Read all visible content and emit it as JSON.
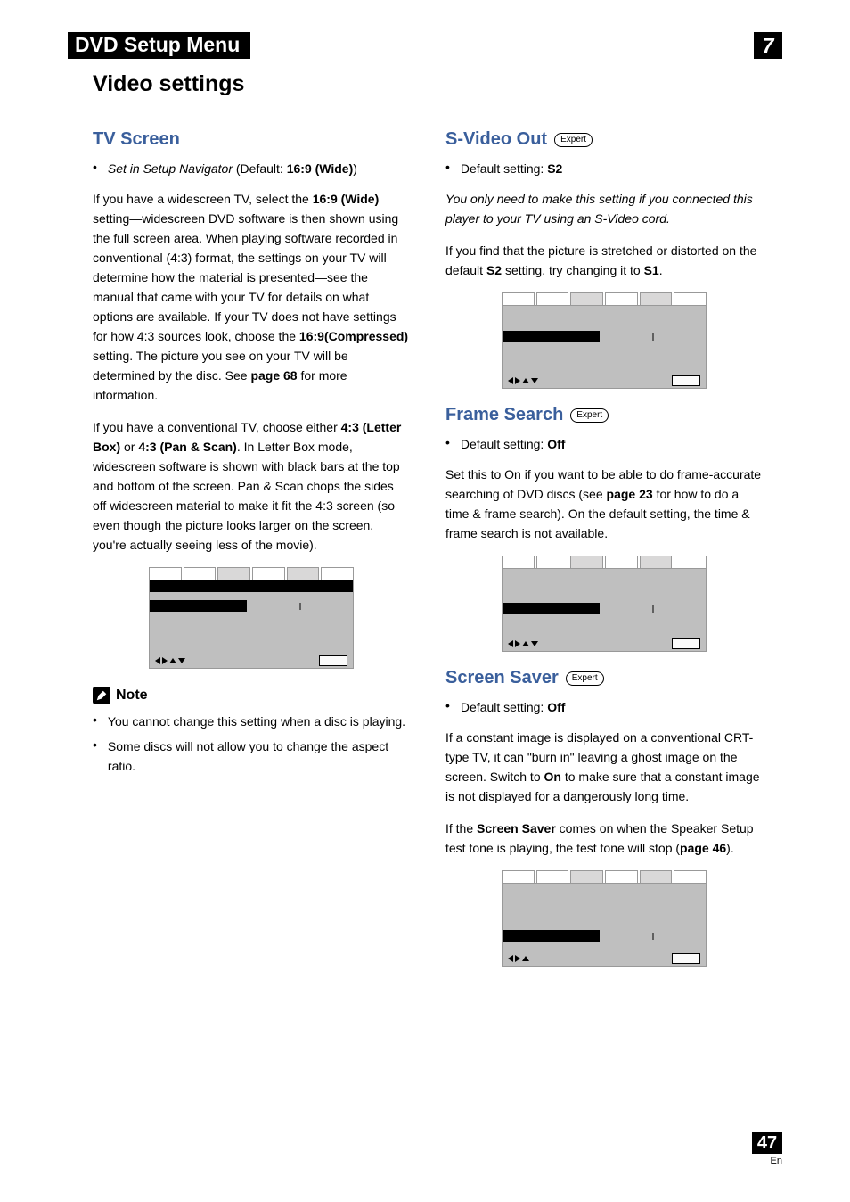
{
  "header": {
    "title": "DVD Setup Menu",
    "chapter": "7"
  },
  "section_title": "Video settings",
  "left": {
    "tv_screen": {
      "heading": "TV Screen",
      "set_in": "Set in Setup Navigator",
      "default_label": " (Default: ",
      "default_value": "16:9 (Wide)",
      "default_close": ")",
      "p1_a": "If you have a widescreen TV, select the ",
      "p1_b": "16:9 (Wide)",
      "p1_c": " setting—widescreen DVD software is then shown using the full screen area. When playing software recorded in conventional (4:3) format, the settings on your TV will determine how the material is presented—see the manual that came with your TV for details on what options are available. If your TV does not have settings for how 4:3 sources look, choose the ",
      "p1_d": "16:9(Compressed)",
      "p1_e": " setting. The picture you see on your TV will be determined by the disc. See ",
      "p1_f": "page 68",
      "p1_g": " for more information.",
      "p2_a": "If you have a conventional TV, choose either ",
      "p2_b": "4:3 (Letter Box)",
      "p2_c": " or ",
      "p2_d": "4:3 (Pan & Scan)",
      "p2_e": ". In Letter Box mode, widescreen software is shown with black bars at the top and bottom of the screen. Pan & Scan chops the sides off widescreen material to make it fit the 4:3 screen (so even though the picture looks larger on the screen, you're actually seeing less of the movie)."
    },
    "note": {
      "title": "Note",
      "items": [
        "You cannot change this setting when a disc is playing.",
        "Some discs will not allow you to change the aspect ratio."
      ]
    }
  },
  "right": {
    "svideo": {
      "heading": "S-Video Out",
      "badge": "Expert",
      "default_label": "Default setting: ",
      "default_value": "S2",
      "p_italic": "You only need to make this setting if you connected this player to your TV using an S-Video cord.",
      "p2_a": "If you find that the picture is stretched or distorted on the default ",
      "p2_b": "S2",
      "p2_c": " setting, try changing it to ",
      "p2_d": "S1",
      "p2_e": "."
    },
    "framesearch": {
      "heading": "Frame Search",
      "badge": "Expert",
      "default_label": "Default setting: ",
      "default_value": "Off",
      "p_a": "Set this to On if you want to be able to do frame-accurate searching of DVD discs (see ",
      "p_b": "page 23",
      "p_c": " for how to do a time & frame search). On the default setting, the time & frame search is not available."
    },
    "screensaver": {
      "heading": "Screen Saver",
      "badge": "Expert",
      "default_label": "Default setting: ",
      "default_value": "Off",
      "p1_a": "If a constant image is displayed on a conventional CRT-type TV, it can \"burn in\" leaving a ghost image on the screen. Switch to ",
      "p1_b": "On",
      "p1_c": " to make sure that a constant image is not displayed for a dangerously long time.",
      "p2_a": "If the ",
      "p2_b": "Screen Saver",
      "p2_c": " comes on when the Speaker Setup test tone is playing, the test tone will stop (",
      "p2_d": "page 46",
      "p2_e": ")."
    }
  },
  "pagenum": {
    "num": "47",
    "lang": "En"
  }
}
